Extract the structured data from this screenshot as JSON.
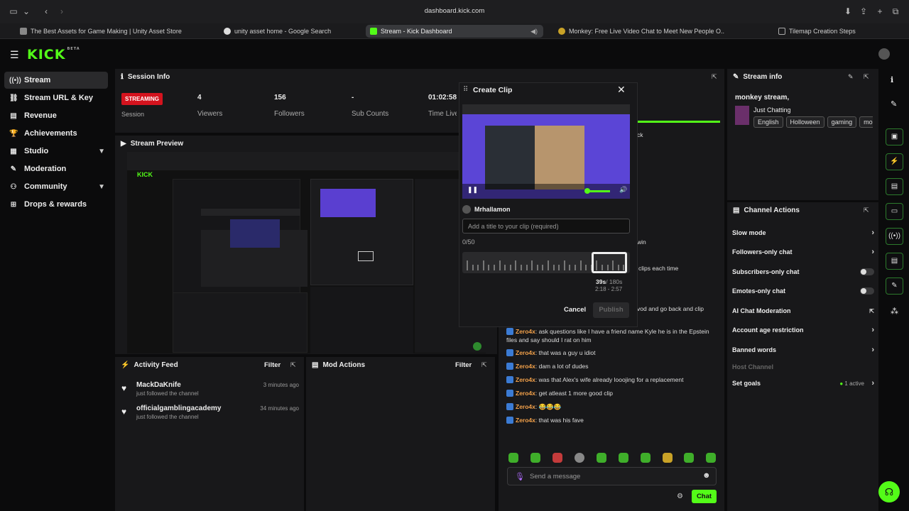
{
  "browser": {
    "url": "dashboard.kick.com",
    "tabs": [
      {
        "label": "The Best Assets for Game Making | Unity Asset Store",
        "icon": "unity-icon"
      },
      {
        "label": "unity asset home - Google Search",
        "icon": "google-icon"
      },
      {
        "label": "Stream - Kick Dashboard",
        "icon": "kick-icon",
        "active": true
      },
      {
        "label": "Monkey: Free Live Video Chat to Meet New People O...",
        "icon": "monkey-icon"
      },
      {
        "label": "Tilemap Creation Steps",
        "icon": "doc-icon"
      }
    ]
  },
  "brand": {
    "logo": "KICK",
    "beta": "BETA",
    "accent": "#53fc18"
  },
  "sidebar": {
    "items": [
      {
        "label": "Stream",
        "icon": "stream-icon",
        "active": true
      },
      {
        "label": "Stream URL & Key",
        "icon": "link-icon"
      },
      {
        "label": "Revenue",
        "icon": "revenue-icon"
      },
      {
        "label": "Achievements",
        "icon": "trophy-icon"
      },
      {
        "label": "Studio",
        "icon": "studio-icon",
        "chevron": true
      },
      {
        "label": "Moderation",
        "icon": "wrench-icon"
      },
      {
        "label": "Community",
        "icon": "community-icon",
        "chevron": true
      },
      {
        "label": "Drops & rewards",
        "icon": "gift-icon"
      }
    ]
  },
  "session": {
    "title": "Session Info",
    "badge": "STREAMING",
    "session_label": "Session",
    "stats": [
      {
        "value": "4",
        "label": "Viewers"
      },
      {
        "value": "156",
        "label": "Followers"
      },
      {
        "value": "-",
        "label": "Sub Counts"
      },
      {
        "value": "01:02:58",
        "label": "Time Live"
      }
    ]
  },
  "preview": {
    "title": "Stream Preview"
  },
  "activity": {
    "title": "Activity Feed",
    "filter": "Filter",
    "items": [
      {
        "name": "MackDaKnife",
        "sub": "just followed the channel",
        "time": "3 minutes ago"
      },
      {
        "name": "officialgamblingacademy",
        "sub": "just followed the channel",
        "time": "34 minutes ago"
      }
    ]
  },
  "mod": {
    "title": "Mod Actions",
    "filter": "Filter"
  },
  "clip": {
    "title": "Create Clip",
    "user": "Mrhallamon",
    "placeholder": "Add a title to your clip (required)",
    "counter": "0/50",
    "duration": "39s",
    "duration_max": "/ 180s",
    "range": "2:18 - 2:57",
    "cancel": "Cancel",
    "publish": "Publish"
  },
  "chat_behind": {
    "t1": "ck",
    "t2": "win",
    "t3": "clips each time",
    "t4": "vod and go back and clip"
  },
  "chat": {
    "messages": [
      {
        "user": "Zero4x",
        "text": ": ask questions like I have a friend name Kyle he is in the Epstein files and say should I rat on him"
      },
      {
        "user": "Zero4x",
        "text": ": that was a guy u idiot"
      },
      {
        "user": "Zero4x",
        "text": ": dam a lot of dudes"
      },
      {
        "user": "Zero4x",
        "text": ": was that Alex's wife already looojing for a replacement"
      },
      {
        "user": "Zero4x",
        "text": ": get atleast 1 more good clip"
      },
      {
        "user": "Zero4x",
        "text": ": 😂😂😂"
      },
      {
        "user": "Zero4x",
        "text": ": that was his fave"
      }
    ],
    "placeholder": "Send a message",
    "send": "Chat"
  },
  "streaminfo": {
    "title": "Stream info",
    "name": "monkey stream,",
    "category": "Just Chatting",
    "tags": [
      "English",
      "Holloween",
      "gaming",
      "mo"
    ]
  },
  "channel": {
    "title": "Channel Actions",
    "actions": [
      {
        "label": "Slow mode",
        "control": "chevron"
      },
      {
        "label": "Followers-only chat",
        "control": "chevron"
      },
      {
        "label": "Subscribers-only chat",
        "control": "toggle"
      },
      {
        "label": "Emotes-only chat",
        "control": "toggle"
      },
      {
        "label": "AI Chat Moderation",
        "control": "external"
      },
      {
        "label": "Account age restriction",
        "control": "chevron"
      },
      {
        "label": "Banned words",
        "control": "chevron"
      },
      {
        "label": "Host Channel",
        "control": "none",
        "disabled": true
      },
      {
        "label": "Set goals",
        "control": "chevron",
        "status": "1 active"
      }
    ]
  }
}
